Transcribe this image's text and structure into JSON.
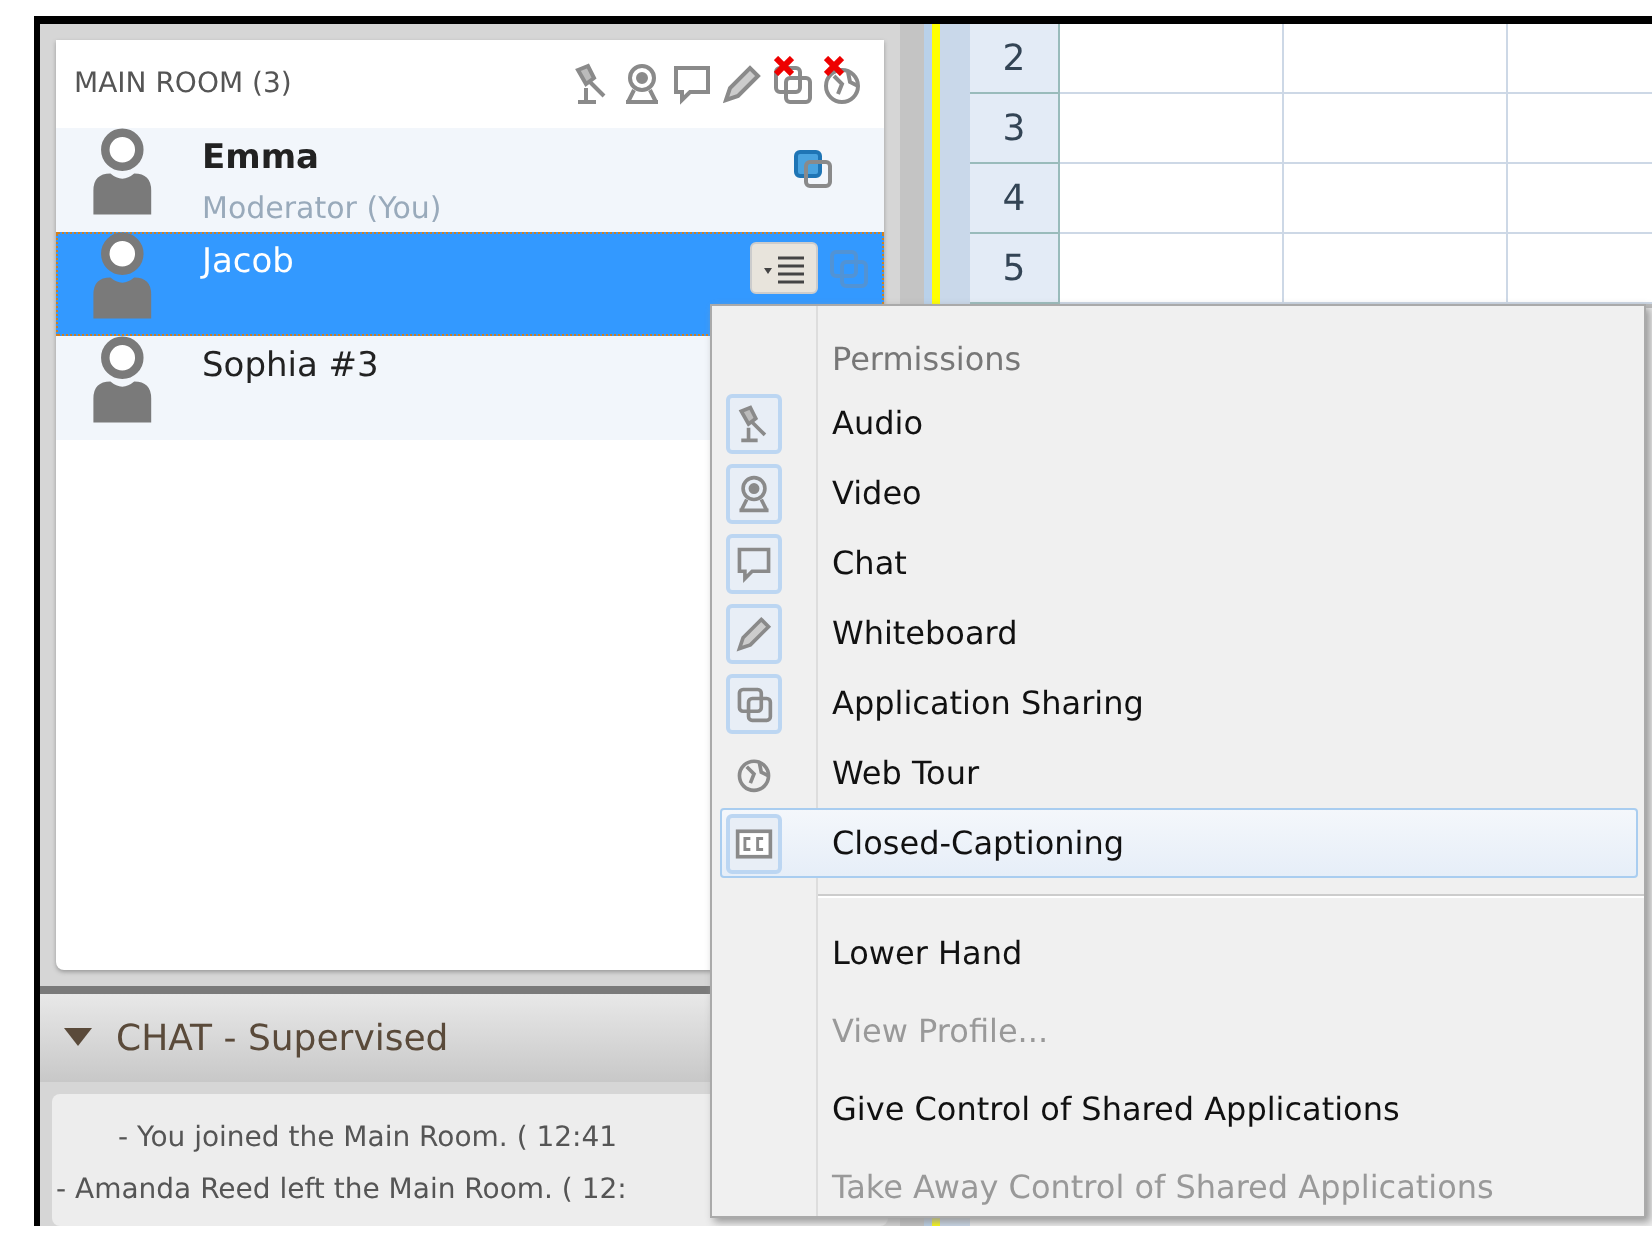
{
  "room": {
    "title": "MAIN ROOM (3)",
    "toolbar": [
      {
        "kind": "microphone",
        "blocked": false
      },
      {
        "kind": "webcam",
        "blocked": false
      },
      {
        "kind": "chat",
        "blocked": false
      },
      {
        "kind": "pencil",
        "blocked": false
      },
      {
        "kind": "sharing",
        "blocked": true
      },
      {
        "kind": "globe",
        "blocked": true
      }
    ],
    "participants": [
      {
        "name": "Emma",
        "role": "Moderator (You)",
        "selected": false,
        "sharing_icon": true,
        "sharing_active": true
      },
      {
        "name": "Jacob",
        "selected": true,
        "sharing_icon": true,
        "sharing_active": false
      },
      {
        "name": "Sophia #3",
        "selected": false
      }
    ]
  },
  "chat": {
    "title": "CHAT - Supervised",
    "expanded": true,
    "messages": [
      {
        "text": "- You joined the Main Room. ( 12:41",
        "indented": true
      },
      {
        "text": "- Amanda Reed left the Main Room. ( 12:",
        "indented": false
      }
    ]
  },
  "sheet": {
    "rows": [
      "2",
      "3",
      "4",
      "5"
    ]
  },
  "menu": {
    "header": "Permissions",
    "permissions": [
      {
        "label": "Audio",
        "kind": "microphone",
        "granted": true,
        "highlighted": false
      },
      {
        "label": "Video",
        "kind": "webcam",
        "granted": true,
        "highlighted": false
      },
      {
        "label": "Chat",
        "kind": "chat",
        "granted": true,
        "highlighted": false
      },
      {
        "label": "Whiteboard",
        "kind": "pencil",
        "granted": true,
        "highlighted": false
      },
      {
        "label": "Application Sharing",
        "kind": "sharing",
        "granted": true,
        "highlighted": false
      },
      {
        "label": "Web Tour",
        "kind": "globe",
        "granted": false,
        "highlighted": false
      },
      {
        "label": "Closed-Captioning",
        "kind": "cc",
        "granted": true,
        "highlighted": true
      }
    ],
    "actions": [
      {
        "label": "Lower Hand",
        "disabled": false
      },
      {
        "label": "View Profile...",
        "disabled": true
      },
      {
        "label": "Give Control of Shared Applications",
        "disabled": false
      },
      {
        "label": "Take Away Control of Shared Applications",
        "disabled": true
      }
    ]
  }
}
